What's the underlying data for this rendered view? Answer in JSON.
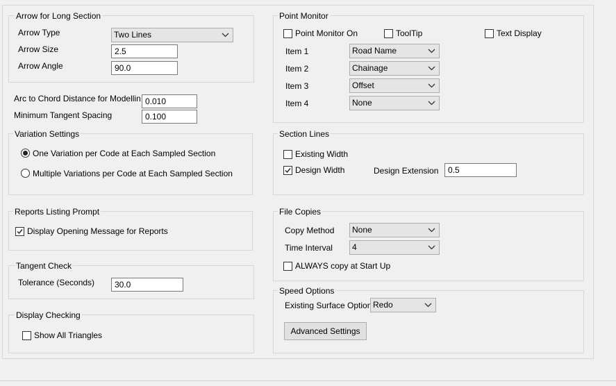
{
  "arrow": {
    "title": "Arrow for Long Section",
    "type_label": "Arrow Type",
    "type_value": "Two Lines",
    "size_label": "Arrow Size",
    "size_value": "2.5",
    "angle_label": "Arrow Angle",
    "angle_value": "90.0"
  },
  "modelling": {
    "arc_label": "Arc to Chord Distance for Modellin",
    "arc_value": "0.010",
    "tangent_label": "Minimum Tangent Spacing",
    "tangent_value": "0.100"
  },
  "variation": {
    "title": "Variation Settings",
    "option1": "One Variation per Code at Each Sampled Section",
    "option2": "Multiple Variations per Code at Each Sampled Section",
    "selected": 1
  },
  "reports": {
    "title": "Reports Listing Prompt",
    "display_opening": "Display Opening Message for Reports",
    "display_opening_checked": true
  },
  "tangent_check": {
    "title": "Tangent Check",
    "tolerance_label": "Tolerance (Seconds)",
    "tolerance_value": "30.0"
  },
  "display_checking": {
    "title": "Display Checking",
    "show_triangles": "Show All Triangles",
    "show_triangles_checked": false
  },
  "point_monitor": {
    "title": "Point Monitor",
    "monitor_on": "Point Monitor On",
    "tooltip": "ToolTip",
    "text_display": "Text Display",
    "items": [
      {
        "label": "Item 1",
        "value": "Road Name"
      },
      {
        "label": "Item 2",
        "value": "Chainage"
      },
      {
        "label": "Item 3",
        "value": "Offset"
      },
      {
        "label": "Item 4",
        "value": "None"
      }
    ]
  },
  "section_lines": {
    "title": "Section Lines",
    "existing_width": "Existing Width",
    "existing_checked": false,
    "design_width": "Design Width",
    "design_checked": true,
    "design_ext_label": "Design Extension",
    "design_ext_value": "0.5"
  },
  "file_copies": {
    "title": "File Copies",
    "method_label": "Copy Method",
    "method_value": "None",
    "interval_label": "Time Interval",
    "interval_value": "4",
    "always_copy": "ALWAYS copy at Start Up",
    "always_checked": false
  },
  "speed": {
    "title": "Speed Options",
    "surface_label": "Existing Surface Option",
    "surface_value": "Redo",
    "advanced_button": "Advanced Settings"
  }
}
